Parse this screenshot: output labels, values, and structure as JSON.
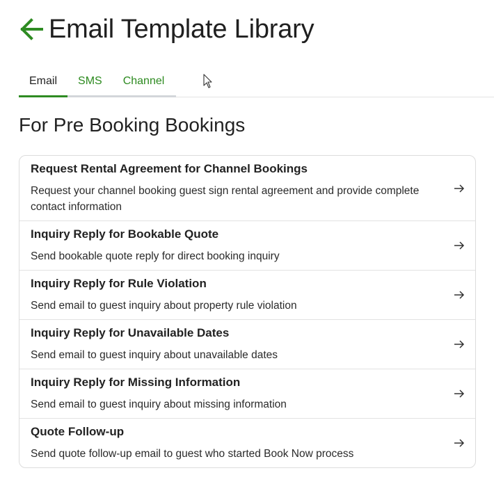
{
  "header": {
    "title": "Email Template Library",
    "back_icon": "arrow-left-icon",
    "accent_color": "#2e8b22"
  },
  "tabs": [
    {
      "label": "Email",
      "active": true
    },
    {
      "label": "SMS",
      "active": false
    },
    {
      "label": "Channel",
      "active": false
    }
  ],
  "section": {
    "title": "For Pre Booking Bookings"
  },
  "templates": [
    {
      "title": "Request Rental Agreement for Channel Bookings",
      "description": "Request your channel booking guest sign rental agreement and provide complete contact information"
    },
    {
      "title": "Inquiry Reply for Bookable Quote",
      "description": "Send bookable quote reply for direct booking inquiry"
    },
    {
      "title": "Inquiry Reply for Rule Violation",
      "description": "Send email to guest inquiry about property rule violation"
    },
    {
      "title": "Inquiry Reply for Unavailable Dates",
      "description": "Send email to guest inquiry about unavailable dates"
    },
    {
      "title": "Inquiry Reply for Missing Information",
      "description": "Send email to guest inquiry about missing information"
    },
    {
      "title": "Quote Follow-up",
      "description": "Send quote follow-up email to guest who started Book Now process"
    }
  ]
}
